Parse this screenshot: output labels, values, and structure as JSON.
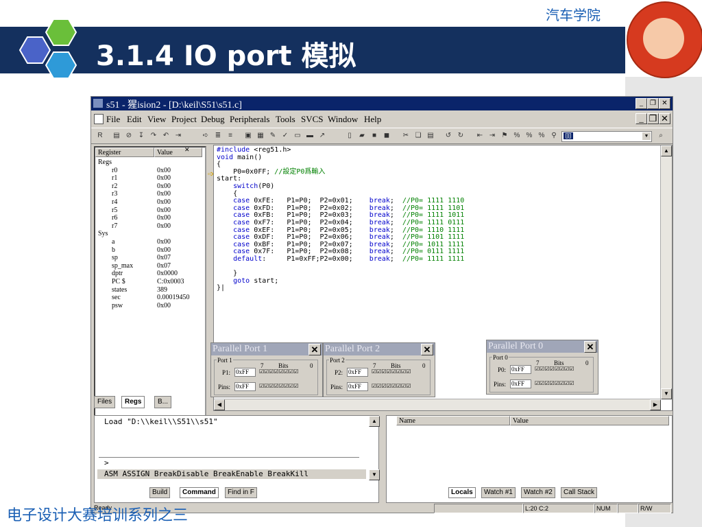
{
  "slide": {
    "college": "汽车学院",
    "title": "3.1.4  IO port 模拟",
    "footer": "电子设计大赛培训系列之三"
  },
  "window": {
    "title": "s51  - 猩ision2 - [D:\\keil\\S51\\s51.c]",
    "menus": [
      "File",
      "Edit",
      "View",
      "Project",
      "Debug",
      "Peripherals",
      "Tools",
      "SVCS",
      "Window",
      "Help"
    ],
    "toolbar_combo": "[][]"
  },
  "registers": {
    "header_register": "Register",
    "header_value": "Value",
    "rows": [
      {
        "name": "Regs",
        "value": ""
      },
      {
        "name": "r0",
        "value": "0x00"
      },
      {
        "name": "r1",
        "value": "0x00"
      },
      {
        "name": "r2",
        "value": "0x00"
      },
      {
        "name": "r3",
        "value": "0x00"
      },
      {
        "name": "r4",
        "value": "0x00"
      },
      {
        "name": "r5",
        "value": "0x00"
      },
      {
        "name": "r6",
        "value": "0x00"
      },
      {
        "name": "r7",
        "value": "0x00"
      },
      {
        "name": "Sys",
        "value": ""
      },
      {
        "name": "a",
        "value": "0x00"
      },
      {
        "name": "b",
        "value": "0x00"
      },
      {
        "name": "sp",
        "value": "0x07"
      },
      {
        "name": "sp_max",
        "value": "0x07"
      },
      {
        "name": "dptr",
        "value": "0x0000"
      },
      {
        "name": "PC  $",
        "value": "C:0x0003"
      },
      {
        "name": "states",
        "value": "389"
      },
      {
        "name": "sec",
        "value": "0.00019450"
      },
      {
        "name": "psw",
        "value": "0x00"
      }
    ],
    "tabs": [
      "Files",
      "Regs",
      "B..."
    ]
  },
  "code_lines": [
    "#include <reg51.h>",
    "void main()",
    "{",
    "    P0=0x0FF; //設定P0爲輸入",
    "start:",
    "    switch(P0)",
    "    {",
    "    case 0xFE:   P1=P0;  P2=0x01;    break;  //P0= 1111 1110",
    "    case 0xFD:   P1=P0;  P2=0x02;    break;  //P0= 1111 1101",
    "    case 0xFB:   P1=P0;  P2=0x03;    break;  //P0= 1111 1011",
    "    case 0xF7:   P1=P0;  P2=0x04;    break;  //P0= 1111 0111",
    "    case 0xEF:   P1=P0;  P2=0x05;    break;  //P0= 1110 1111",
    "    case 0xDF:   P1=P0;  P2=0x06;    break;  //P0= 1101 1111",
    "    case 0xBF:   P1=P0;  P2=0x07;    break;  //P0= 1011 1111",
    "    case 0x7F:   P1=P0;  P2=0x08;    break;  //P0= 0111 1111",
    "    default:     P1=0xFF;P2=0x00;    break;  //P0= 1111 1111",
    "",
    "    }",
    "    goto start;",
    "}|"
  ],
  "ports": [
    {
      "title": "Parallel Port 1",
      "group": "Port 1",
      "reg_label": "P1:",
      "reg_value": "0xFF",
      "pins_label": "Pins:",
      "pins_value": "0xFF",
      "bit_hi": "7",
      "bits_label": "Bits",
      "bit_lo": "0",
      "checks": "☑☑☑☑☑☑☑☑"
    },
    {
      "title": "Parallel Port 2",
      "group": "Port 2",
      "reg_label": "P2:",
      "reg_value": "0xFF",
      "pins_label": "Pins:",
      "pins_value": "0xFF",
      "bit_hi": "7",
      "bits_label": "Bits",
      "bit_lo": "0",
      "checks": "☑☑☑☑☑☑☑☑"
    },
    {
      "title": "Parallel Port 0",
      "group": "Port 0",
      "reg_label": "P0:",
      "reg_value": "0xFF",
      "pins_label": "Pins:",
      "pins_value": "0xFF",
      "bit_hi": "7",
      "bits_label": "Bits",
      "bit_lo": "0",
      "checks": "☑☑☑☑☑☑☑☑"
    }
  ],
  "command": {
    "line1": "Load \"D:\\\\keil\\\\S51\\\\s51\"",
    "prompt": ">",
    "hint": "ASM ASSIGN BreakDisable BreakEnable BreakKill",
    "tabs": [
      "Build",
      "Command",
      "Find in F"
    ]
  },
  "watch": {
    "col_name": "Name",
    "col_value": "Value",
    "tabs": [
      "Locals",
      "Watch #1",
      "Watch #2",
      "Call Stack"
    ]
  },
  "status": {
    "ready": "Ready",
    "position": "L:20 C:2",
    "num": "NUM",
    "rw": "R/W"
  }
}
